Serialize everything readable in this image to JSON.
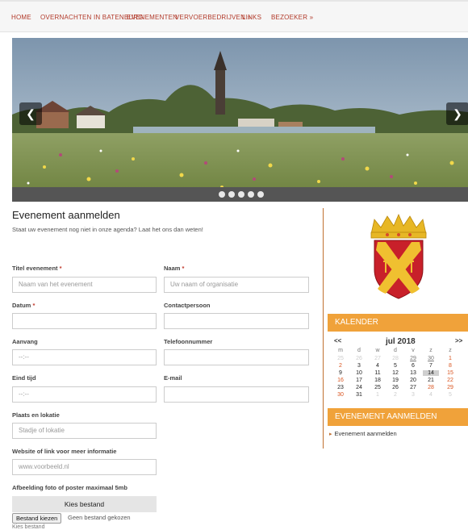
{
  "nav": {
    "items": [
      {
        "label": "HOME"
      },
      {
        "label": "OVERNACHTEN IN BATENBURG"
      },
      {
        "label": "EVENEMENTEN"
      },
      {
        "label": "VERVOERBEDRIJVEN »"
      },
      {
        "label": "LINKS"
      },
      {
        "label": "BEZOEKER »"
      }
    ]
  },
  "slider": {
    "prev_icon": "chevron-left-icon",
    "next_icon": "chevron-right-icon",
    "dot_count": 5,
    "active_dot": 0
  },
  "main": {
    "title": "Evenement aanmelden",
    "intro": "Staat uw evenement nog niet in onze agenda? Laat het ons dan weten!"
  },
  "form": {
    "titel_label": "Titel evenement",
    "titel_placeholder": "Naam van het evenement",
    "naam_label": "Naam",
    "naam_placeholder": "Uw naam of organisatie",
    "datum_label": "Datum",
    "contact_label": "Contactpersoon",
    "aanvang_label": "Aanvang",
    "aanvang_value": "--:--",
    "telefoon_label": "Telefoonnummer",
    "eind_label": "Eind tijd",
    "eind_value": "--:--",
    "email_label": "E-mail",
    "plaats_label": "Plaats en lokatie",
    "plaats_placeholder": "Stadje of lokatie",
    "website_label": "Website of link voor meer informatie",
    "website_placeholder": "www.voorbeeld.nl",
    "afbeelding_label": "Afbeelding foto of poster maximaal 5mb",
    "upload_button": "Kies bestand",
    "file_button": "Bestand kiezen",
    "file_status": "Geen bestand gekozen",
    "kies_below": "Kies bestand",
    "required_mark": "*"
  },
  "sidebar": {
    "crest_icon": "coat-of-arms-icon",
    "calendar_heading": "KALENDER",
    "calendar": {
      "prev": "<<",
      "next": ">>",
      "month_title": "jul 2018",
      "weekdays": [
        "m",
        "d",
        "w",
        "d",
        "v",
        "z",
        "z"
      ],
      "weeks": [
        [
          "25",
          "26",
          "27",
          "28",
          "29",
          "30",
          "1"
        ],
        [
          "2",
          "3",
          "4",
          "5",
          "6",
          "7",
          "8"
        ],
        [
          "9",
          "10",
          "11",
          "12",
          "13",
          "14",
          "15"
        ],
        [
          "16",
          "17",
          "18",
          "19",
          "20",
          "21",
          "22"
        ],
        [
          "23",
          "24",
          "25",
          "26",
          "27",
          "28",
          "29"
        ],
        [
          "30",
          "31",
          "1",
          "2",
          "3",
          "4",
          "5"
        ]
      ],
      "today": "14"
    },
    "event_heading": "EVENEMENT AANMELDEN",
    "event_link": "Evenement aanmelden"
  },
  "colors": {
    "accent": "#f0a23a",
    "nav_text": "#b23a2a",
    "required": "#c0392b"
  }
}
